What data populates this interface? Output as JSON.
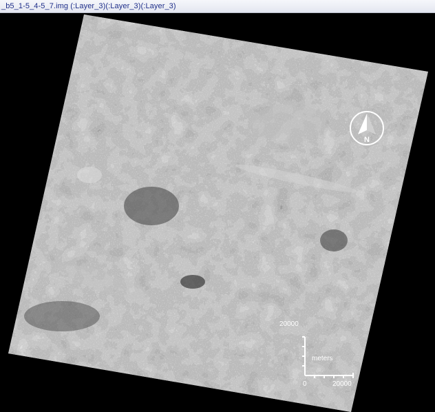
{
  "window": {
    "title": "_b5_1-5_4-5_7.img (:Layer_3)(:Layer_3)(:Layer_3)"
  },
  "map": {
    "north_label": "N",
    "scale": {
      "y_max": "20000",
      "x_max": "20000",
      "origin": "0",
      "units": "meters"
    }
  },
  "colors": {
    "background": "#000000",
    "title_text": "#1f2f8a",
    "raster_base": "#8a8a8a"
  }
}
